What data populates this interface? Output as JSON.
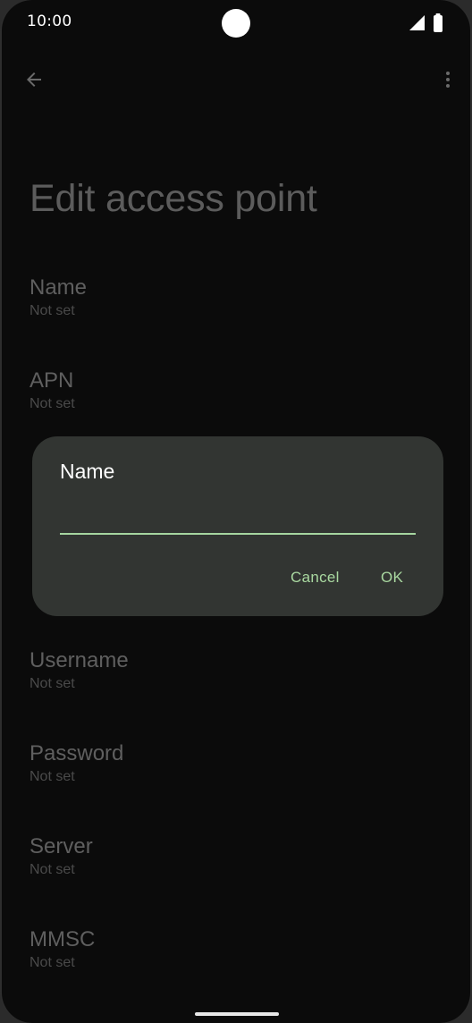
{
  "status_bar": {
    "time": "10:00",
    "icons": [
      "signal-icon",
      "battery-icon"
    ]
  },
  "app_bar": {
    "back_icon": "arrow-back-icon",
    "menu_icon": "more-vert-icon"
  },
  "page": {
    "title": "Edit access point",
    "preferences": [
      {
        "title": "Name",
        "summary": "Not set"
      },
      {
        "title": "APN",
        "summary": "Not set"
      },
      {
        "title": "Username",
        "summary": "Not set"
      },
      {
        "title": "Password",
        "summary": "Not set"
      },
      {
        "title": "Server",
        "summary": "Not set"
      },
      {
        "title": "MMSC",
        "summary": "Not set"
      }
    ]
  },
  "dialog": {
    "title": "Name",
    "input_value": "",
    "cancel_label": "Cancel",
    "ok_label": "OK"
  },
  "colors": {
    "accent": "#a9d8a0",
    "dialog_bg": "#323532",
    "screen_bg": "#0b0b0b"
  }
}
